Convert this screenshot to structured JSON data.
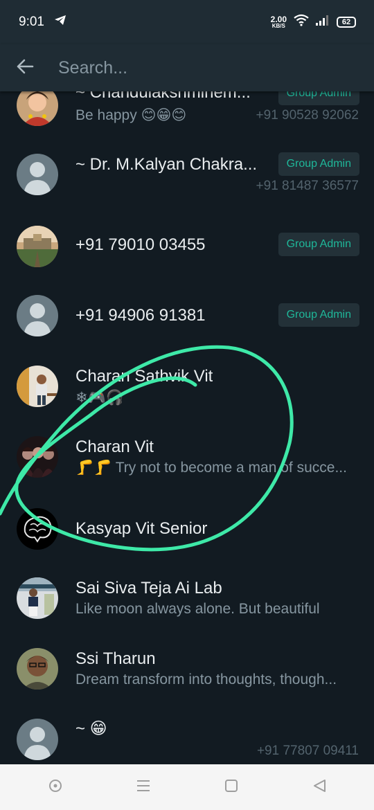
{
  "status_bar": {
    "time": "9:01",
    "speed_value": "2.00",
    "speed_unit": "KB/S",
    "battery": "62"
  },
  "search": {
    "placeholder": "Search..."
  },
  "contacts": [
    {
      "name": "~ Chandulakshminem...",
      "about": "Be happy 😊😁😊",
      "badge": "Group Admin",
      "phone": "+91 90528 92062"
    },
    {
      "name": "~ Dr. M.Kalyan Chakra...",
      "badge": "Group Admin",
      "phone": "+91 81487 36577"
    },
    {
      "name": "+91 79010 03455",
      "badge": "Group Admin"
    },
    {
      "name": "+91 94906 91381",
      "badge": "Group Admin"
    },
    {
      "name": "Charan Sathvik Vit",
      "about": "❄🎮🎧"
    },
    {
      "name": "Charan Vit",
      "about": "🦵🦵 Try not to become a man of succe..."
    },
    {
      "name": "Kasyap Vit Senior"
    },
    {
      "name": "Sai Siva Teja Ai Lab",
      "about": "Like moon always alone.  But beautiful"
    },
    {
      "name": "Ssi Tharun",
      "about": "Dream transform into thoughts, though..."
    },
    {
      "name": "~ 😁",
      "phone": "+91 77807 09411"
    }
  ],
  "icons": {
    "back": "arrow-left-icon",
    "telegram": "telegram-icon",
    "wifi": "wifi-icon",
    "signal": "signal-icon",
    "nav_home": "circle-icon",
    "nav_menu": "menu-icon",
    "nav_square": "square-icon",
    "nav_back": "triangle-back-icon"
  },
  "colors": {
    "background": "#121b22",
    "header": "#1f2c34",
    "badge_text": "#1fb89a",
    "annotation": "#3ee9a8"
  }
}
